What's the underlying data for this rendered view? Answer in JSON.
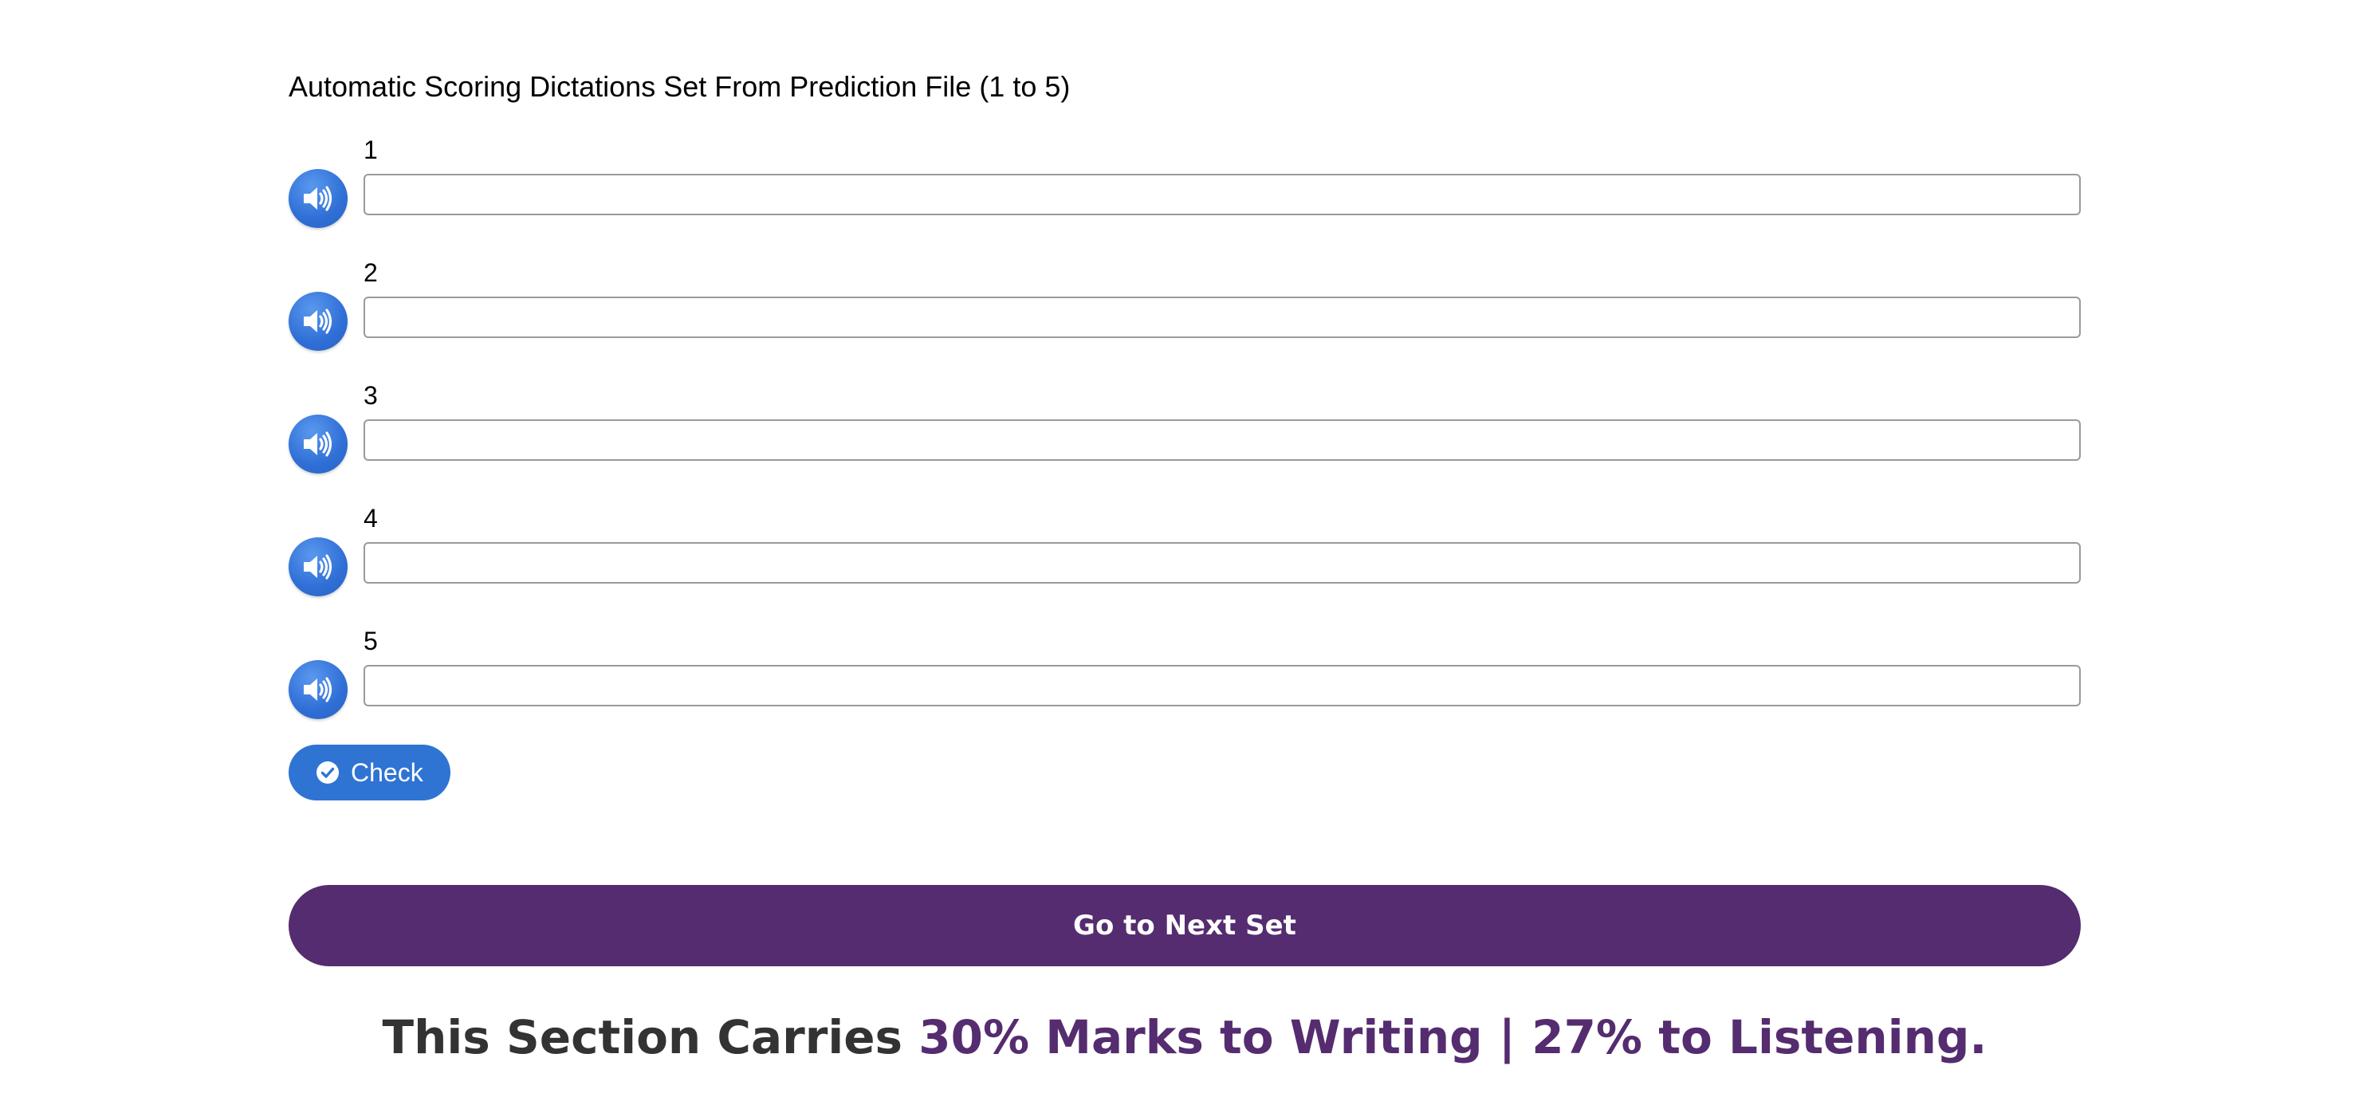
{
  "heading": "Automatic Scoring Dictations Set From Prediction File (1 to 5)",
  "items": [
    {
      "number": "1",
      "value": "",
      "placeholder": ""
    },
    {
      "number": "2",
      "value": "",
      "placeholder": ""
    },
    {
      "number": "3",
      "value": "",
      "placeholder": ""
    },
    {
      "number": "4",
      "value": "",
      "placeholder": ""
    },
    {
      "number": "5",
      "value": "",
      "placeholder": ""
    }
  ],
  "icons": {
    "play": "speaker-volume-icon",
    "check": "check-circle-icon"
  },
  "check_button": {
    "label": "Check"
  },
  "next_button": {
    "label": "Go to Next Set"
  },
  "marks_info": {
    "prefix": "This Section Carries ",
    "highlight": "30% Marks to Writing | 27% to Listening."
  },
  "colors": {
    "accent_purple": "#552c6f",
    "button_blue": "#2f74d3",
    "dark_text": "#333333"
  }
}
